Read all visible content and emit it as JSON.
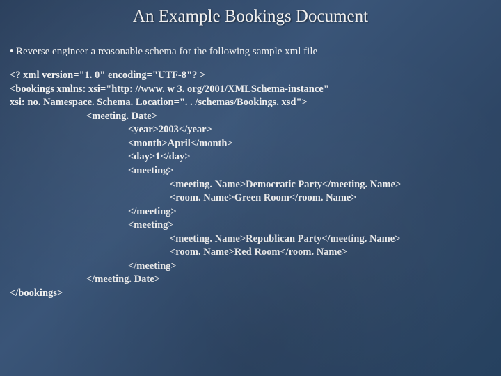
{
  "title": "An Example Bookings Document",
  "bullet": "• Reverse engineer a reasonable schema for the following sample xml file",
  "xml": {
    "l0": "<? xml version=\"1. 0\" encoding=\"UTF-8\"? >",
    "l1": "<bookings xmlns: xsi=\"http: //www. w 3. org/2001/XMLSchema-instance\"",
    "l2": "xsi: no. Namespace. Schema. Location=\". . /schemas/Bookings. xsd\">",
    "l3": "<meeting. Date>",
    "l4": "<year>2003</year>",
    "l5": "<month>April</month>",
    "l6": "<day>1</day>",
    "l7": "<meeting>",
    "l8": "<meeting. Name>Democratic Party</meeting. Name>",
    "l9": "<room. Name>Green Room</room. Name>",
    "l10": "</meeting>",
    "l11": "<meeting>",
    "l12": "<meeting. Name>Republican Party</meeting. Name>",
    "l13": "<room. Name>Red Room</room. Name>",
    "l14": "</meeting>",
    "l15": "</meeting. Date>",
    "l16": "</bookings>"
  }
}
